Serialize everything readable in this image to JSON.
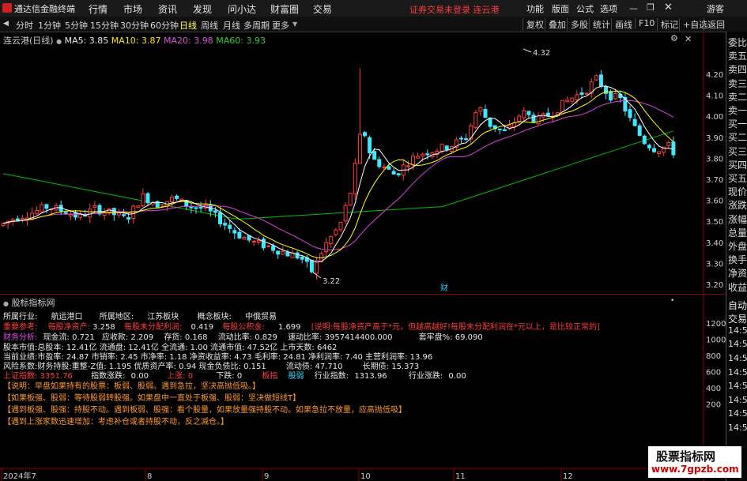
{
  "app": {
    "title": "通达信金融终端",
    "menus": [
      "行情",
      "市场",
      "资讯",
      "发现",
      "问小达",
      "财富圈",
      "交易"
    ],
    "notice": "证券交易未登录  连云港",
    "right_menus": [
      "功能",
      "版面",
      "公式",
      "选项"
    ],
    "guest": "游客"
  },
  "periods": {
    "items": [
      "分时",
      "1分钟",
      "5分钟",
      "15分钟",
      "30分钟",
      "60分钟",
      "日线",
      "周线",
      "月线",
      "多周期",
      "更多"
    ],
    "selected": "日线"
  },
  "toolbar": {
    "buttons": [
      "复权",
      "叠加",
      "多股",
      "统计",
      "画线",
      "F10",
      "标记",
      "+自选",
      "返回"
    ]
  },
  "chart": {
    "stock_label": "连云港(日线)",
    "ma5": "MA5: 3.85",
    "ma10": "MA10: 3.87",
    "ma20": "MA20: 3.98",
    "ma60": "MA60: 3.93",
    "colors": {
      "ma5": "#ffffff",
      "ma10": "#ffff00",
      "ma20": "#e040e0",
      "ma60": "#00c000",
      "up": "#ff3c3c",
      "down": "#40e8ff"
    },
    "high_label": "4.32",
    "low_label": "3.22",
    "marker": "财",
    "price_ticks": [
      "4.20",
      "4.10",
      "4.00",
      "3.90",
      "3.80",
      "3.70",
      "3.60",
      "3.50",
      "3.40",
      "3.30",
      "3.20"
    ],
    "date_ticks": [
      "2024年7",
      "8",
      "9",
      "10",
      "11",
      "12"
    ]
  },
  "chart_data": {
    "type": "candlestick",
    "price_range": [
      3.17,
      4.32
    ],
    "ma_last": {
      "MA5": 3.85,
      "MA10": 3.87,
      "MA20": 3.98,
      "MA60": 3.93
    },
    "high": 4.32,
    "low": 3.22
  },
  "indicator": {
    "title": "股标指标网",
    "sub_ticks": [
      "1200",
      "1000",
      "800",
      "600",
      "400",
      "200"
    ],
    "r1": [
      "所属行业:",
      "航运港口",
      "所属地区:",
      "江苏板块",
      "概念板块:",
      "中俄贸易"
    ],
    "r2": [
      "重要参考:",
      "每股净资产:",
      "3.258",
      "每股未分配利润:",
      "0.419",
      "每股公积金:",
      "1.699",
      "[说明:每股净资产高于*元，但越高越好!每股未分配利润在*元以上，是比较正常的]"
    ],
    "r3": [
      "财务分析:",
      "现金流: 0.721",
      "应收款: 2.209",
      "存货: 0.168",
      "流动比率: 0.829",
      "速动比率: 3957414400.000",
      "套牢盘%: 69.090"
    ],
    "r4": "股本市值:总股本: 12.41亿 流通盘: 12.41亿 全流通: 1.00 流通市值: 47.52亿 上市天数: 6462",
    "r5": "当前业绩:市盈率: 24.87 市销率: 2.45 市净率: 1.18 净资收益率: 4.73 毛利率: 24.81 净利润率: 7.40 主营利润率: 13.96",
    "r6": [
      "风险系数:财务持股:重整-Z值: 1.195 优质资产率: 0.94 现金负债比: 0.151",
      "流动债: 47.710",
      "长期债: 15.373"
    ],
    "r7": [
      "上证指数:",
      "3351.76",
      "指数涨跌:",
      "0.00",
      "上涨:",
      "0",
      "下跌:",
      "0",
      "板指",
      "股弱",
      "行业指数:",
      "1313.96",
      "行业涨跌:",
      "0.00"
    ],
    "notes": [
      "【说明：早盘如果持有的股票：板弱、股弱。遇到急拉，坚决高抛低吸。】",
      "【如果板强、股弱：等待股弱转股强。如果盘中一直处于板强、股弱：坚决做短线T】",
      "【遇到板强、股强：持股不动。遇到板弱、股强：看个股量，如果放量强持股不动。如果急拉不放量，应高抛低吸】",
      "【遇到上涨家数迅速增加：考虑补仓或者持股不动，反之减仓。】"
    ]
  },
  "right_panel": {
    "items": [
      "委比",
      "卖五",
      "卖四",
      "卖三",
      "卖二",
      "卖一",
      "买一",
      "买二",
      "买三",
      "买四",
      "买五",
      "现价",
      "涨跌",
      "涨幅",
      "总量",
      "外盘",
      "换手",
      "净资",
      "收益",
      "自动",
      "交易",
      "14:5",
      "14:5",
      "14:5",
      "14:5",
      "14:5",
      "14:5",
      "14:5",
      "14:5"
    ]
  },
  "watermark": {
    "line1": "股票指标网",
    "line2": "www.7gpzb.com"
  }
}
